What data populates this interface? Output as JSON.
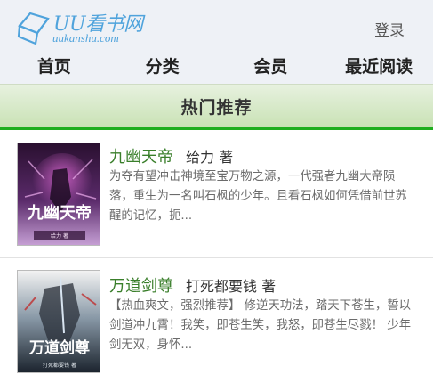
{
  "header": {
    "logo": {
      "text": "UU看书网",
      "sub": "uukanshu.com",
      "icon": "book-logo-icon"
    },
    "login_label": "登录"
  },
  "nav": {
    "items": [
      {
        "label": "首页"
      },
      {
        "label": "分类"
      },
      {
        "label": "会员"
      },
      {
        "label": "最近阅读"
      }
    ]
  },
  "section": {
    "title": "热门推荐"
  },
  "books": [
    {
      "title": "九幽天帝",
      "author": "给力 著",
      "description": "为夺有望冲击神境至宝万物之源，一代强者九幽大帝陨落，重生为一名叫石枫的少年。且看石枫如何凭借前世苏醒的记忆，扼...",
      "cover_text": "九幽天帝",
      "cover_sub": "给力 著"
    },
    {
      "title": "万道剑尊",
      "author": "打死都要钱 著",
      "description": "【热血爽文，强烈推荐】    修逆天功法，踏天下苍生，誓以剑道冲九霄！我笑，即苍生笑，我怒，即苍生尽戮！    少年剑无双，身怀...",
      "cover_text": "万道剑尊",
      "cover_sub": "打死都要钱 著"
    }
  ],
  "colors": {
    "accent_green": "#1fae1f",
    "title_green": "#3a7f2b",
    "logo_blue": "#4fa3dc"
  }
}
